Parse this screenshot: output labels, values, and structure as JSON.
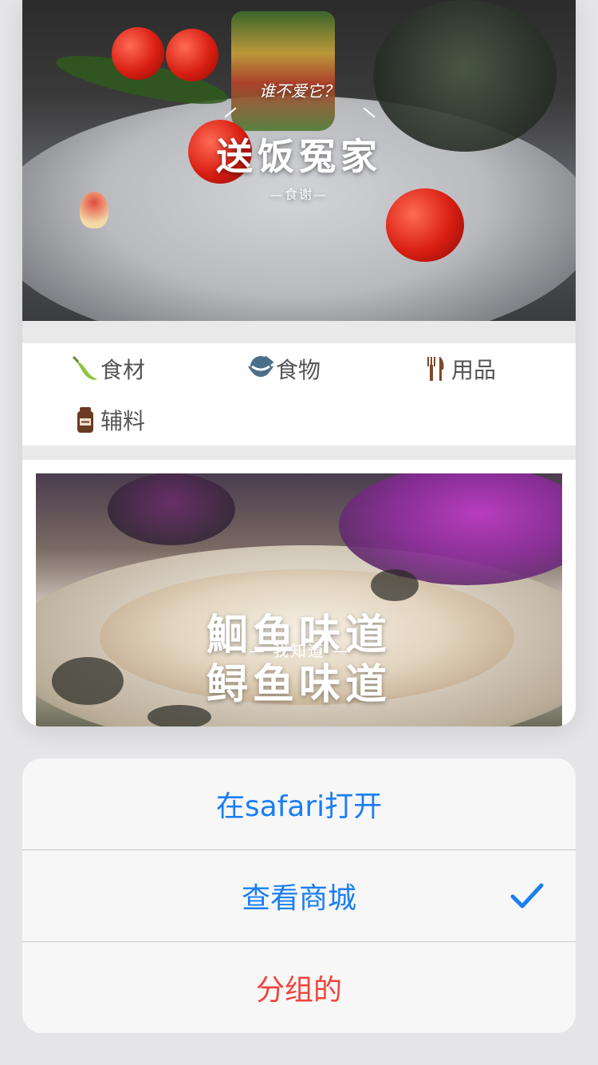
{
  "preview": {
    "hero": {
      "tagline": "谁不爱它？",
      "title": "送饭冤家",
      "subtitle": "—食谢—"
    },
    "categories": [
      {
        "label": "食材",
        "icon": "pepper-icon"
      },
      {
        "label": "食物",
        "icon": "bowl-icon"
      },
      {
        "label": "用品",
        "icon": "utensils-icon"
      },
      {
        "label": "辅料",
        "icon": "jar-icon"
      }
    ],
    "food_banner": {
      "title_line1": "鮰鱼味道",
      "title_line2": "鲟鱼味道",
      "subtitle": "— 我知道 —"
    }
  },
  "action_sheet": {
    "open_in_safari": "在safari打开",
    "view_mall": "查看商城",
    "view_mall_selected": true,
    "grouped": "分组的"
  },
  "colors": {
    "action_blue": "#1a7ef5",
    "destructive_red": "#f2433c",
    "background": "#e5e5e7"
  }
}
